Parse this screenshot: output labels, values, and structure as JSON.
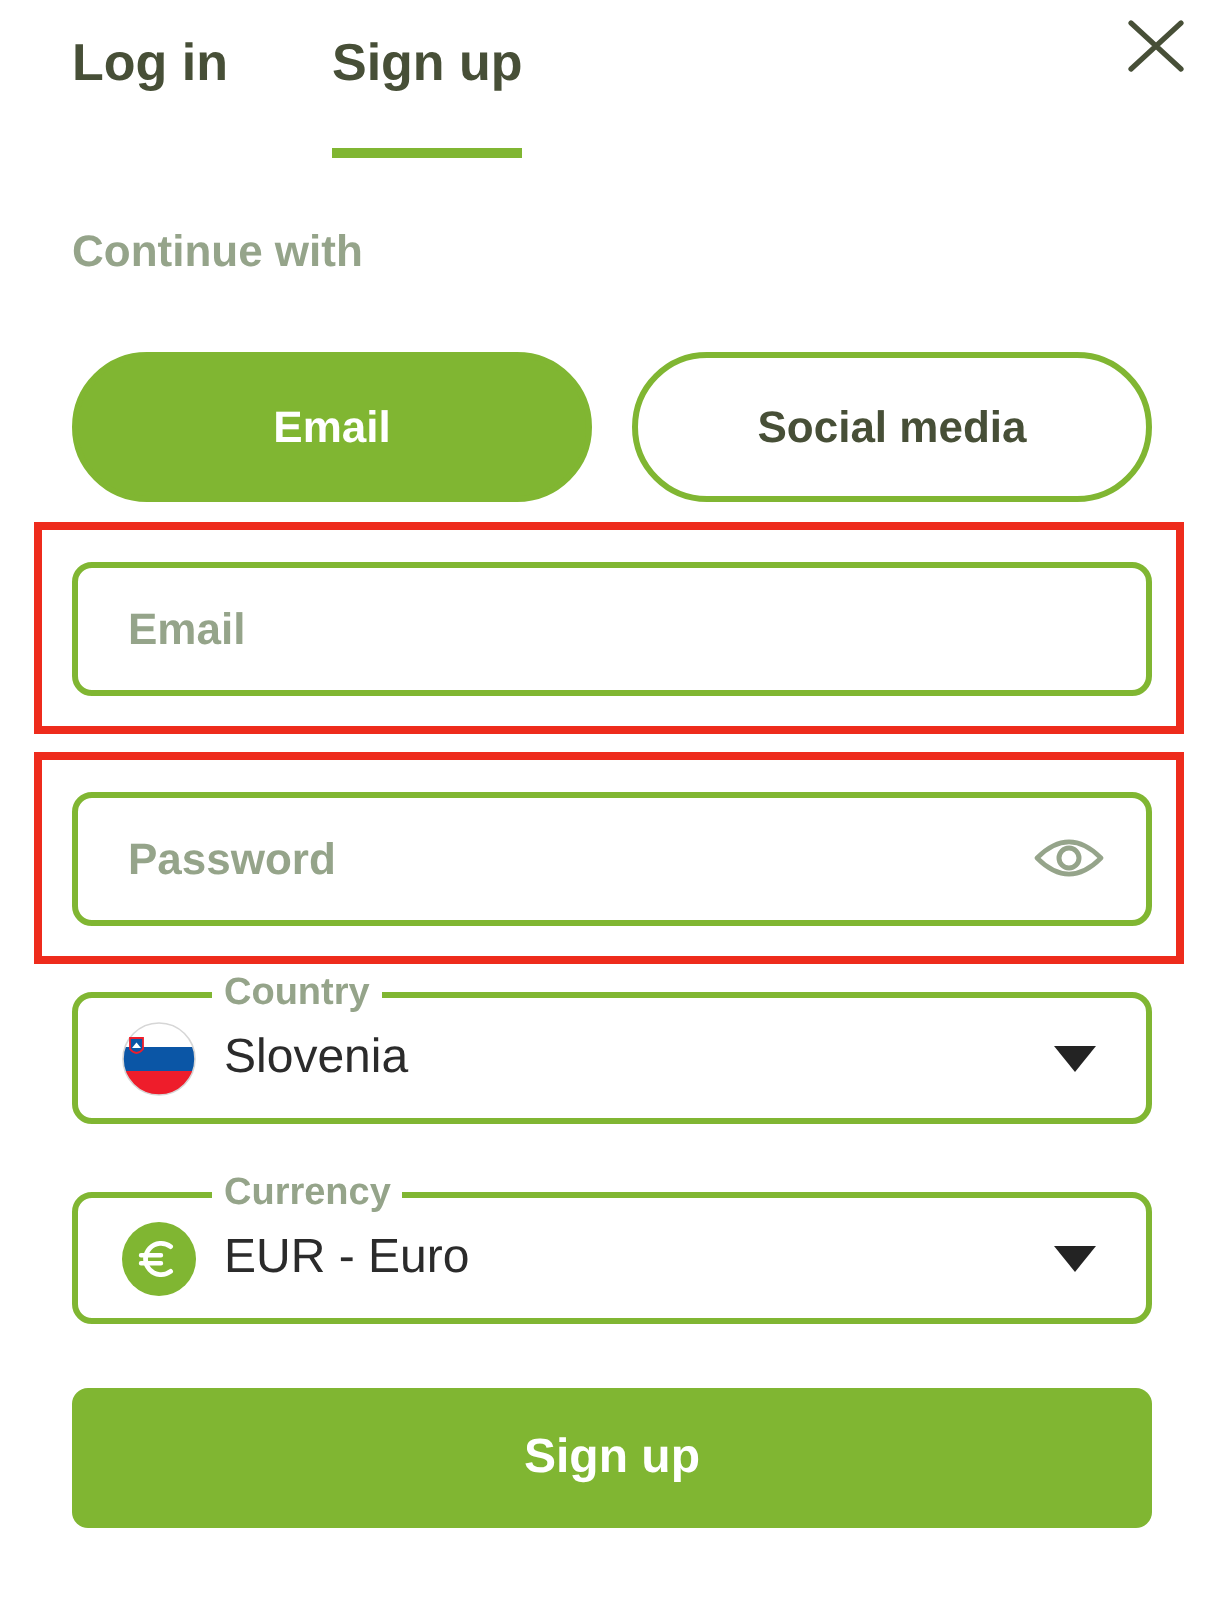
{
  "tabs": [
    {
      "label": "Log in",
      "selected": false
    },
    {
      "label": "Sign up",
      "selected": true
    }
  ],
  "continue_with": {
    "label": "Continue with",
    "options": [
      {
        "label": "Email",
        "selected": true
      },
      {
        "label": "Social media",
        "selected": false
      }
    ]
  },
  "fields": [
    {
      "kind": "email",
      "placeholder": "Email",
      "highlighted": true
    },
    {
      "kind": "password",
      "placeholder": "Password",
      "highlighted": true
    }
  ],
  "selects": [
    {
      "kind": "country",
      "label": "Country",
      "value": "Slovenia"
    },
    {
      "kind": "currency",
      "label": "Currency",
      "value": "EUR - Euro"
    }
  ],
  "submit_button": {
    "label": "Sign up"
  }
}
